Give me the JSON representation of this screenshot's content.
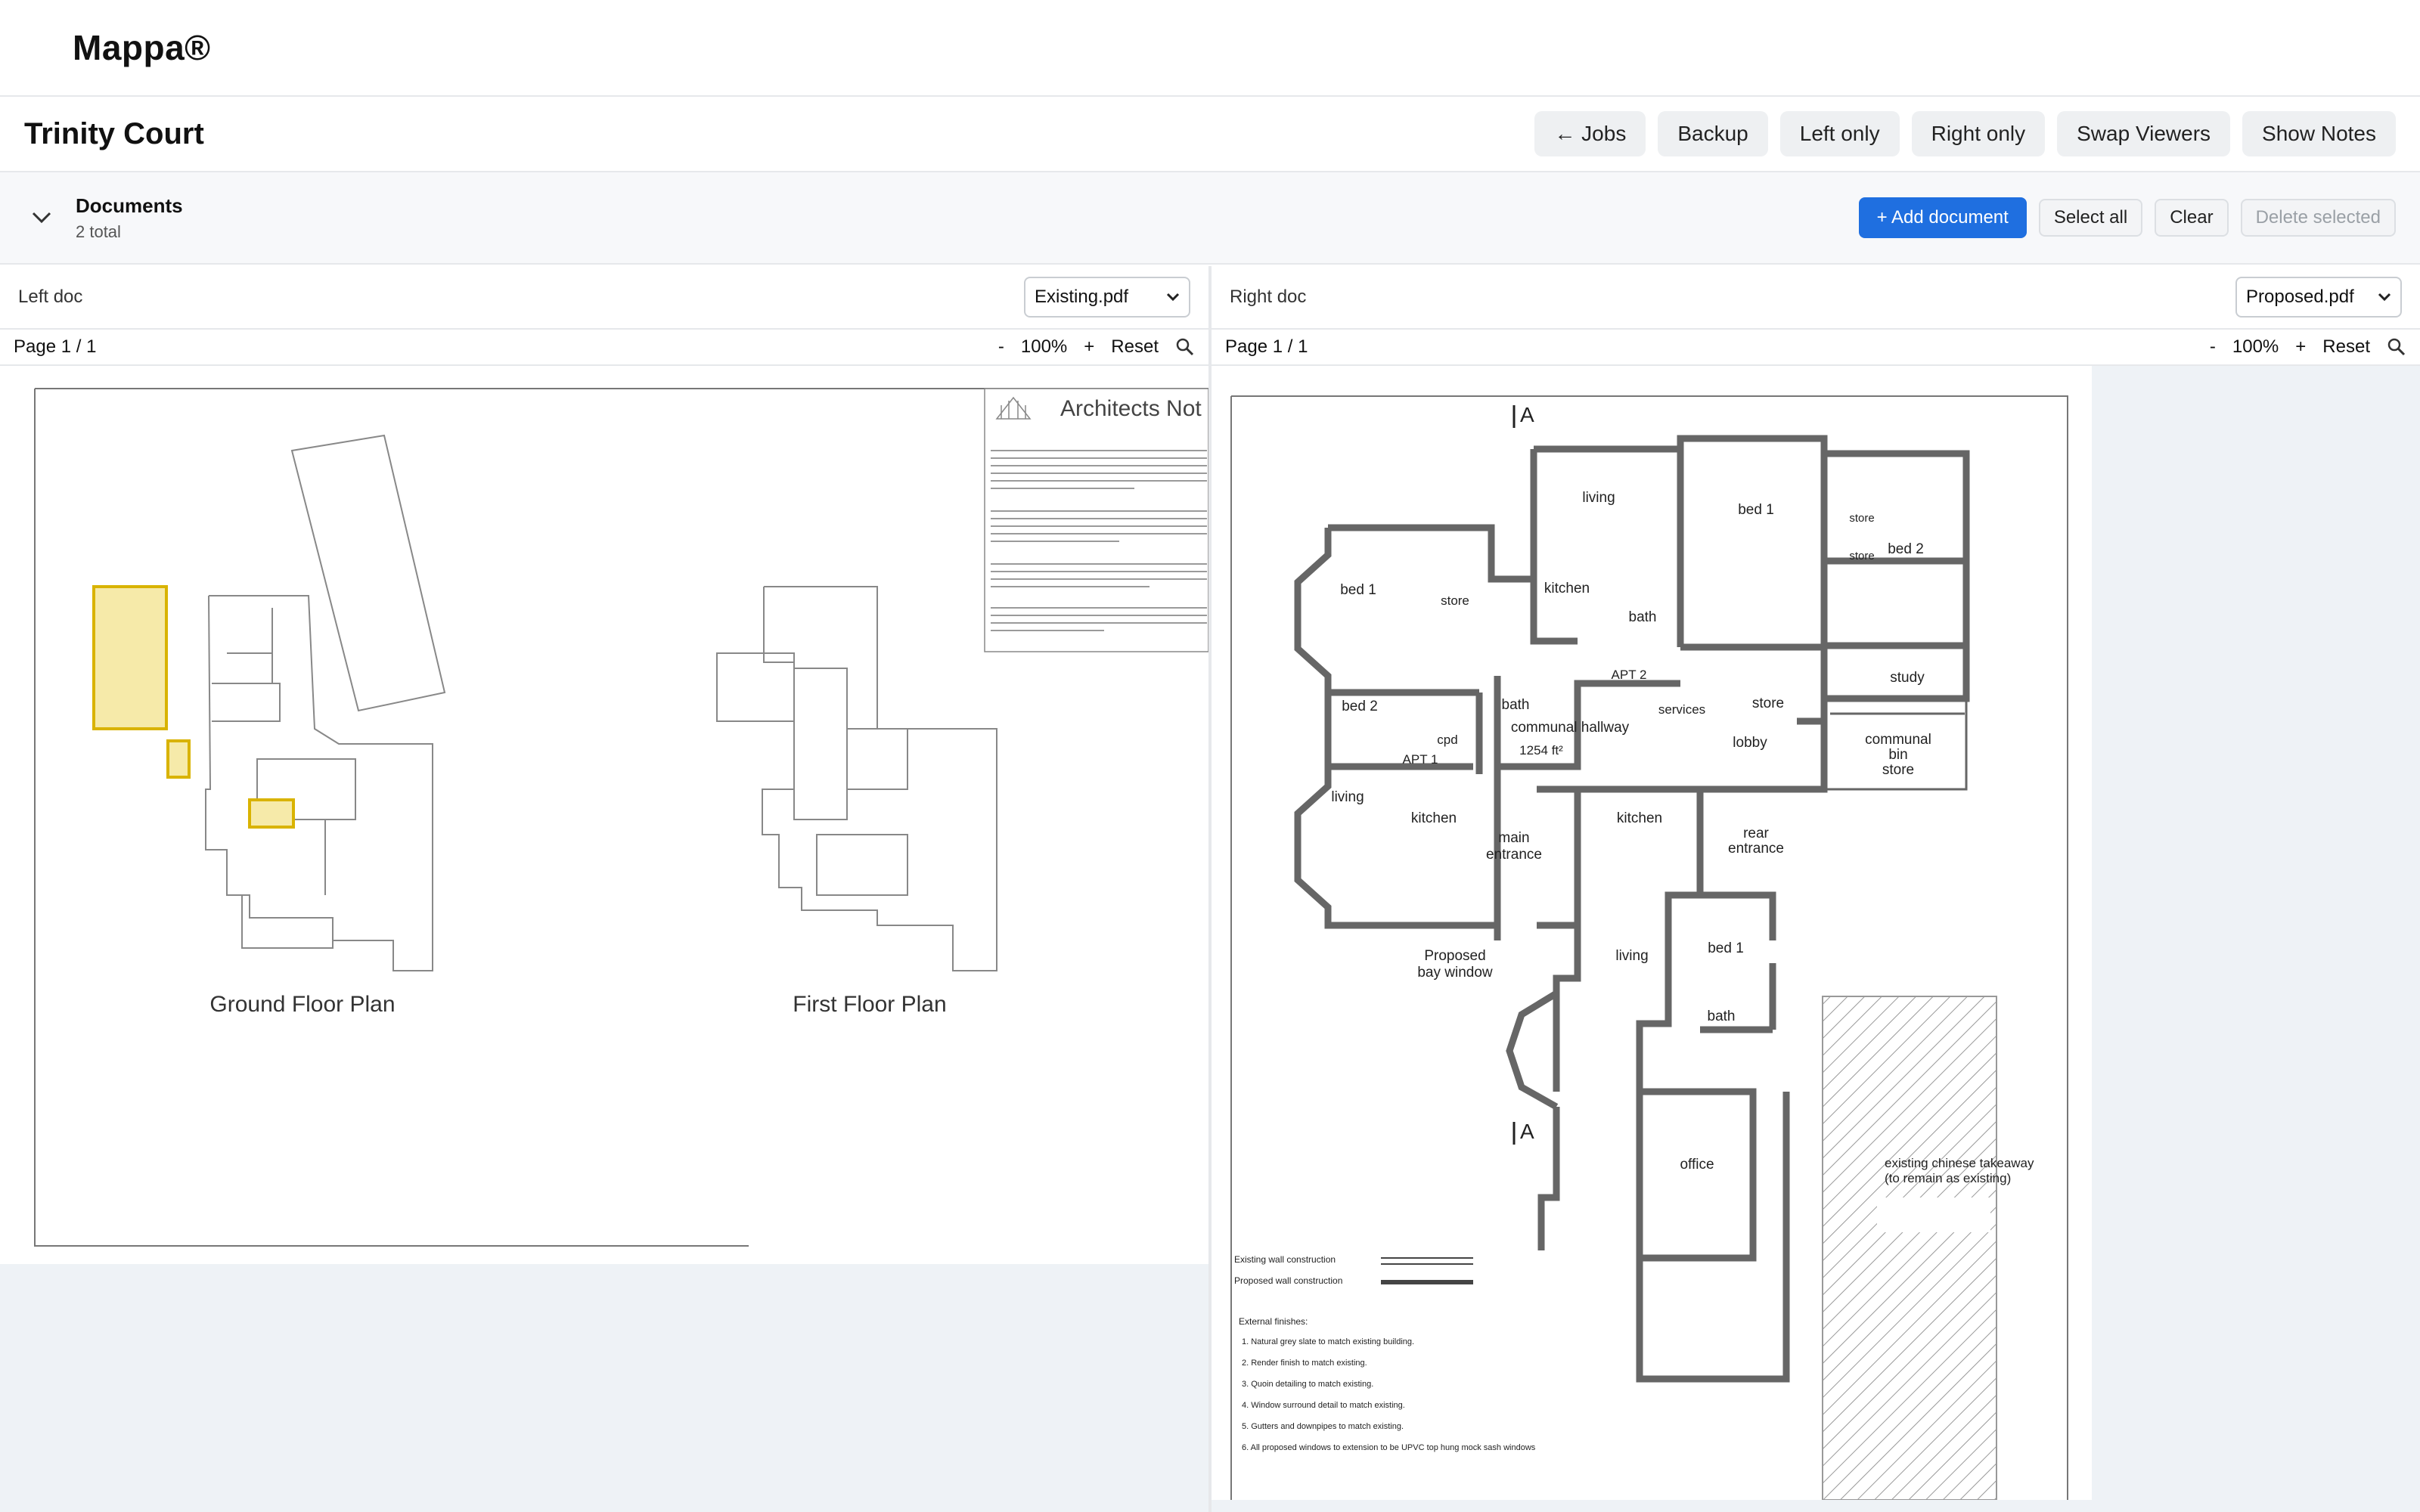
{
  "app": {
    "title": "Mappa®"
  },
  "job": {
    "title": "Trinity Court"
  },
  "toolbar": {
    "jobs": "← Jobs",
    "backup": "Backup",
    "left_only": "Left only",
    "right_only": "Right only",
    "swap": "Swap Viewers",
    "notes": "Show Notes"
  },
  "documents": {
    "title": "Documents",
    "count": "2 total",
    "add": "+ Add document",
    "select_all": "Select all",
    "clear": "Clear",
    "delete": "Delete selected"
  },
  "left_viewer": {
    "label": "Left doc",
    "selected": "Existing.pdf",
    "page": "Page 1 / 1",
    "zoom_out": "-",
    "zoom": "100%",
    "zoom_in": "+",
    "reset": "Reset",
    "drawing": {
      "notes_title": "Architects Not",
      "ground_label": "Ground Floor Plan",
      "first_label": "First Floor Plan"
    }
  },
  "right_viewer": {
    "label": "Right doc",
    "selected": "Proposed.pdf",
    "page": "Page 1 / 1",
    "zoom_out": "-",
    "zoom": "100%",
    "zoom_in": "+",
    "reset": "Reset",
    "drawing": {
      "rooms": {
        "living_top": "living",
        "bed1_top": "bed 1",
        "bed2_top": "bed 2",
        "kitchen_top": "kitchen",
        "bath_top": "bath",
        "store_a": "store",
        "store_b": "store",
        "study": "study",
        "apt2": "APT 2",
        "services": "services",
        "store_c": "store",
        "bed1_left": "bed 1",
        "store_left": "store",
        "bed2_left": "bed 2",
        "bath_left": "bath",
        "cpd": "cpd",
        "communal_hallway": "communal hallway",
        "area": "1254 ft²",
        "apt1": "APT 1",
        "living_left": "living",
        "kitchen_left": "kitchen",
        "lobby": "lobby",
        "bin_store_1": "communal",
        "bin_store_2": "bin",
        "bin_store_3": "store",
        "main_entrance_1": "main",
        "main_entrance_2": "entrance",
        "rear_entrance_1": "rear",
        "rear_entrance_2": "entrance",
        "kitchen_lower": "kitchen",
        "bay_1": "Proposed",
        "bay_2": "bay window",
        "living_lower": "living",
        "bed1_lower": "bed 1",
        "bath_lower": "bath",
        "office": "office",
        "takeaway_1": "existing chinese takeaway",
        "takeaway_2": "(to remain as existing)",
        "section_a": "A",
        "section_b": "A"
      },
      "legend_existing": "Existing wall construction",
      "legend_proposed": "Proposed wall construction",
      "finishes_title": "External finishes:",
      "finishes": [
        "1. Natural grey slate to match existing building.",
        "2. Render finish to match existing.",
        "3. Quoin detailing to match existing.",
        "4. Window surround detail to match existing.",
        "5. Gutters and downpipes to match existing.",
        "6. All proposed windows to extension to be UPVC top hung mock sash windows"
      ]
    }
  }
}
